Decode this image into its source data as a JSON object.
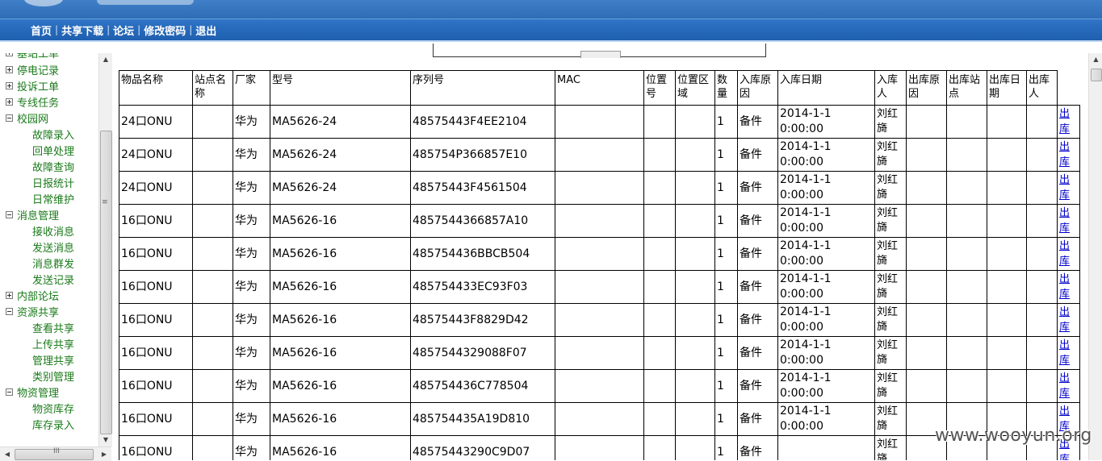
{
  "nav": {
    "home": "首页",
    "share_download": "共享下载",
    "forum": "论坛",
    "change_password": "修改密码",
    "logout": "退出",
    "separator": "|"
  },
  "sidebar": {
    "items": [
      {
        "label": "基站工单",
        "expanded": false
      },
      {
        "label": "停电记录",
        "expanded": false
      },
      {
        "label": "投诉工单",
        "expanded": false
      },
      {
        "label": "专线任务",
        "expanded": false
      },
      {
        "label": "校园网",
        "expanded": true,
        "children": [
          "故障录入",
          "回单处理",
          "故障查询",
          "日报统计",
          "日常维护"
        ]
      },
      {
        "label": "消息管理",
        "expanded": true,
        "children": [
          "接收消息",
          "发送消息",
          "消息群发",
          "发送记录"
        ]
      },
      {
        "label": "内部论坛",
        "expanded": false
      },
      {
        "label": "资源共享",
        "expanded": true,
        "children": [
          "查看共享",
          "上传共享",
          "管理共享",
          "类别管理"
        ]
      },
      {
        "label": "物资管理",
        "expanded": true,
        "children": [
          "物资库存",
          "库存录入"
        ]
      }
    ],
    "scroll_grip": "≡",
    "hscroll_grip": "III"
  },
  "table": {
    "headers": [
      "物品名称",
      "站点名称",
      "厂家",
      "型号",
      "序列号",
      "MAC",
      "位置号",
      "位置区域",
      "数量",
      "入库原因",
      "入库日期",
      "入库人",
      "出库原因",
      "出库站点",
      "出库日期",
      "出库人"
    ],
    "action_label": "出库",
    "rows": [
      [
        "24口ONU",
        "",
        "华为",
        "MA5626-24",
        "48575443F4EE2104",
        "",
        "",
        "",
        "1",
        "备件",
        "2014-1-1 0:00:00",
        "刘红旖",
        "",
        "",
        "",
        ""
      ],
      [
        "24口ONU",
        "",
        "华为",
        "MA5626-24",
        "485754P366857E10",
        "",
        "",
        "",
        "1",
        "备件",
        "2014-1-1 0:00:00",
        "刘红旖",
        "",
        "",
        "",
        ""
      ],
      [
        "24口ONU",
        "",
        "华为",
        "MA5626-24",
        "48575443F4561504",
        "",
        "",
        "",
        "1",
        "备件",
        "2014-1-1 0:00:00",
        "刘红旖",
        "",
        "",
        "",
        ""
      ],
      [
        "16口ONU",
        "",
        "华为",
        "MA5626-16",
        "4857544366857A10",
        "",
        "",
        "",
        "1",
        "备件",
        "2014-1-1 0:00:00",
        "刘红旖",
        "",
        "",
        "",
        ""
      ],
      [
        "16口ONU",
        "",
        "华为",
        "MA5626-16",
        "485754436BBCB504",
        "",
        "",
        "",
        "1",
        "备件",
        "2014-1-1 0:00:00",
        "刘红旖",
        "",
        "",
        "",
        ""
      ],
      [
        "16口ONU",
        "",
        "华为",
        "MA5626-16",
        "485754433EC93F03",
        "",
        "",
        "",
        "1",
        "备件",
        "2014-1-1 0:00:00",
        "刘红旖",
        "",
        "",
        "",
        ""
      ],
      [
        "16口ONU",
        "",
        "华为",
        "MA5626-16",
        "48575443F8829D42",
        "",
        "",
        "",
        "1",
        "备件",
        "2014-1-1 0:00:00",
        "刘红旖",
        "",
        "",
        "",
        ""
      ],
      [
        "16口ONU",
        "",
        "华为",
        "MA5626-16",
        "4857544329088F07",
        "",
        "",
        "",
        "1",
        "备件",
        "2014-1-1 0:00:00",
        "刘红旖",
        "",
        "",
        "",
        ""
      ],
      [
        "16口ONU",
        "",
        "华为",
        "MA5626-16",
        "485754436C778504",
        "",
        "",
        "",
        "1",
        "备件",
        "2014-1-1 0:00:00",
        "刘红旖",
        "",
        "",
        "",
        ""
      ],
      [
        "16口ONU",
        "",
        "华为",
        "MA5626-16",
        "485754435A19D810",
        "",
        "",
        "",
        "1",
        "备件",
        "2014-1-1 0:00:00",
        "刘红旖",
        "",
        "",
        "",
        ""
      ],
      [
        "16口ONU",
        "",
        "华为",
        "MA5626-16",
        "48575443290C9D07",
        "",
        "",
        "",
        "1",
        "备件",
        "",
        "刘红旖",
        "",
        "",
        "",
        ""
      ]
    ]
  },
  "watermark": "www.wooyun.org",
  "colors": {
    "header_blue": "#2f6db5",
    "tree_green": "#1a7a1a",
    "link_blue": "#0000cc"
  }
}
